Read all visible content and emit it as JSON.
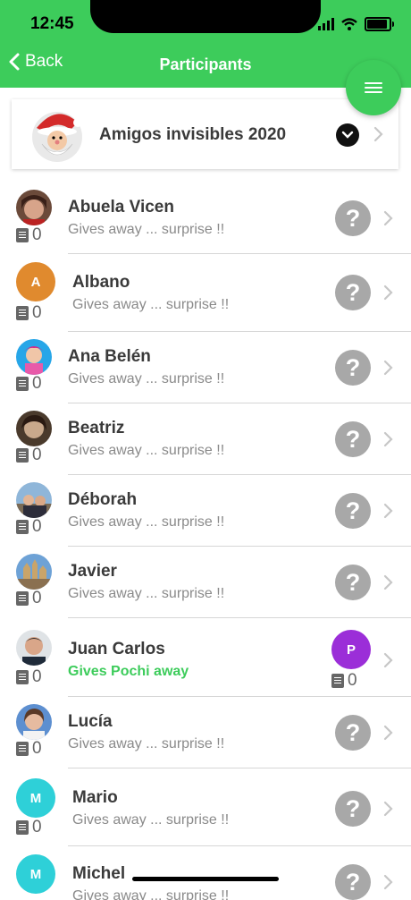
{
  "status_bar": {
    "time": "12:45"
  },
  "nav": {
    "back_label": "Back",
    "title": "Participants"
  },
  "group": {
    "name": "Amigos invisibles 2020"
  },
  "colors": {
    "brand": "#3dcc5b",
    "question": "#a8a8a8",
    "name": "#3a3a3a",
    "subtitle": "#8a8a8a"
  },
  "participants": [
    {
      "name": "Abuela Vicen",
      "subtitle": "Gives away ... surprise !!",
      "count": "0"
    },
    {
      "name": "Albano",
      "subtitle": "Gives away ... surprise !!",
      "count": "0",
      "initial": "A",
      "avatar_color": "#e08a2e"
    },
    {
      "name": "Ana Belén",
      "subtitle": "Gives away ... surprise !!",
      "count": "0"
    },
    {
      "name": "Beatriz",
      "subtitle": "Gives away ... surprise !!",
      "count": "0"
    },
    {
      "name": "Déborah",
      "subtitle": "Gives away ... surprise !!",
      "count": "0"
    },
    {
      "name": "Javier",
      "subtitle": "Gives away ... surprise !!",
      "count": "0"
    },
    {
      "name": "Juan Carlos",
      "subtitle": "Gives Pochi away",
      "count": "0",
      "assignee_initial": "P",
      "assignee_color": "#9b2ed8",
      "assignee_count": "0"
    },
    {
      "name": "Lucía",
      "subtitle": "Gives away ... surprise !!",
      "count": "0"
    },
    {
      "name": "Mario",
      "subtitle": "Gives away ... surprise !!",
      "count": "0",
      "initial": "M",
      "avatar_color": "#2ed0d8"
    },
    {
      "name": "Michel",
      "subtitle": "Gives away ... surprise !!",
      "count": "0",
      "initial": "M",
      "avatar_color": "#2ed0d8"
    }
  ],
  "question_mark": "?"
}
